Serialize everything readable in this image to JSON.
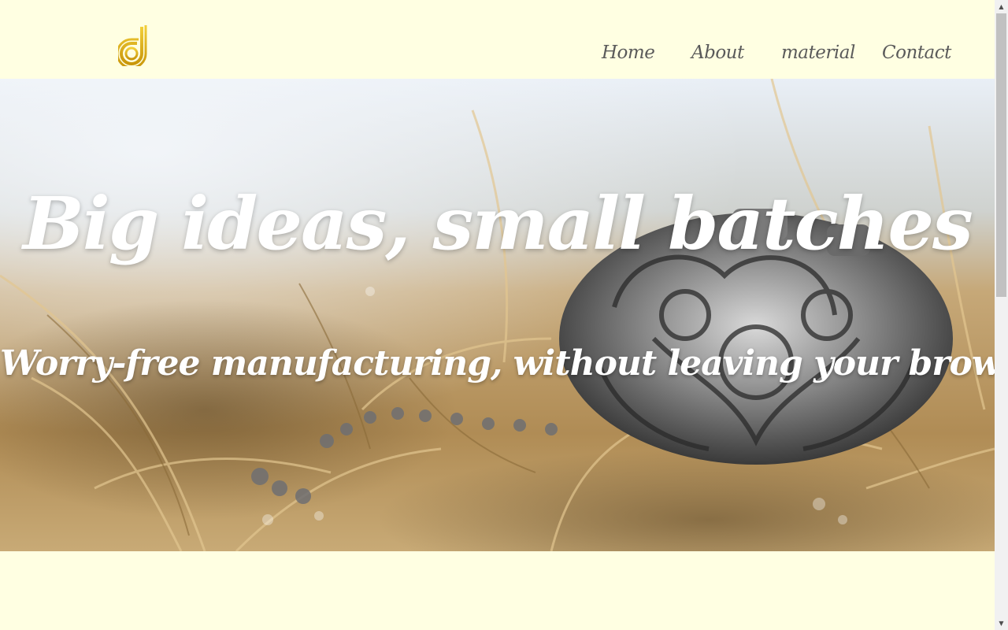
{
  "brand": {
    "logo_icon": "d-monogram-logo",
    "accent_color": "#e0b20f"
  },
  "nav": {
    "items": [
      {
        "label": "Home"
      },
      {
        "label": "About"
      },
      {
        "label": "material"
      },
      {
        "label": "Contact"
      }
    ]
  },
  "hero": {
    "title": "Big ideas, small batches",
    "subtitle": "Worry-free manufacturing, without leaving your browser",
    "image": "silver-heart-locket-in-dry-grass"
  },
  "colors": {
    "page_background": "#ffffe2",
    "nav_text": "#5a5a5a",
    "hero_text": "#ffffff"
  }
}
